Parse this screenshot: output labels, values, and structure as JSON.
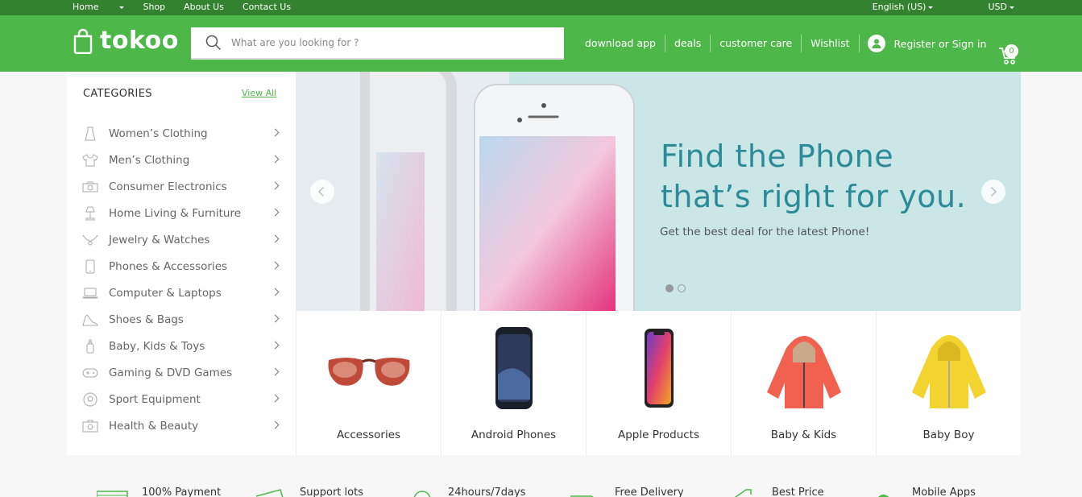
{
  "topbar": {
    "left": [
      "Home",
      "Shop",
      "About Us",
      "Contact Us"
    ],
    "language": "English (US)",
    "currency": "USD"
  },
  "header": {
    "logo": "tokoo",
    "search_placeholder": "What are you looking for ?",
    "links": [
      "download app",
      "deals",
      "customer care",
      "Wishlist"
    ],
    "account": "Register or Sign in",
    "cart_count": "0"
  },
  "sidebar": {
    "title": "CATEGORIES",
    "view_all": "View All",
    "items": [
      {
        "label": "Women’s Clothing",
        "icon": "dress-icon"
      },
      {
        "label": "Men’s Clothing",
        "icon": "tshirt-icon"
      },
      {
        "label": "Consumer Electronics",
        "icon": "camera-icon"
      },
      {
        "label": "Home Living & Furniture",
        "icon": "lamp-icon"
      },
      {
        "label": "Jewelry & Watches",
        "icon": "necklace-icon"
      },
      {
        "label": "Phones & Accessories",
        "icon": "phone-icon"
      },
      {
        "label": "Computer & Laptops",
        "icon": "laptop-icon"
      },
      {
        "label": "Shoes & Bags",
        "icon": "shoe-icon"
      },
      {
        "label": "Baby, Kids & Toys",
        "icon": "bottle-icon"
      },
      {
        "label": "Gaming & DVD Games",
        "icon": "gamepad-icon"
      },
      {
        "label": "Sport Equipment",
        "icon": "ball-icon"
      },
      {
        "label": "Health & Beauty",
        "icon": "health-icon"
      }
    ]
  },
  "banner": {
    "headline_line1": "Find the Phone",
    "headline_line2": "that’s right for you.",
    "subtitle": "Get the best deal for the latest Phone!"
  },
  "tiles": [
    "Accessories",
    "Android Phones",
    "Apple Products",
    "Baby & Kids",
    "Baby Boy"
  ],
  "features": [
    "100% Payment",
    "Support lots",
    "24hours/7days",
    "Free Delivery",
    "Best Price",
    "Mobile Apps"
  ],
  "colors": {
    "brand": "#4eb74a",
    "topbar": "#33822f",
    "banner_bg": "#cbe6e7",
    "headline": "#2c8b97"
  }
}
